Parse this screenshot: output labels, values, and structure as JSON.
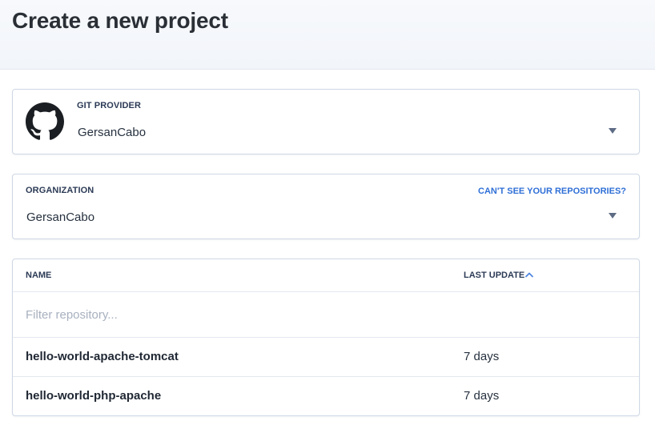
{
  "page": {
    "title": "Create a new project"
  },
  "git_provider": {
    "label": "GIT PROVIDER",
    "value": "GersanCabo",
    "icon": "github-icon"
  },
  "organization": {
    "label": "ORGANIZATION",
    "value": "GersanCabo",
    "help_link": "CAN'T SEE YOUR REPOSITORIES?"
  },
  "repositories": {
    "columns": {
      "name": "NAME",
      "last_update": "LAST UPDATE"
    },
    "sort_direction": "ascending",
    "filter_placeholder": "Filter repository...",
    "rows": [
      {
        "name": "hello-world-apache-tomcat",
        "last_update": "7 days"
      },
      {
        "name": "hello-world-php-apache",
        "last_update": "7 days"
      }
    ]
  },
  "colors": {
    "link": "#2f6fd6",
    "border": "#cfd8e6",
    "header_bg": "#f4f7fb"
  }
}
